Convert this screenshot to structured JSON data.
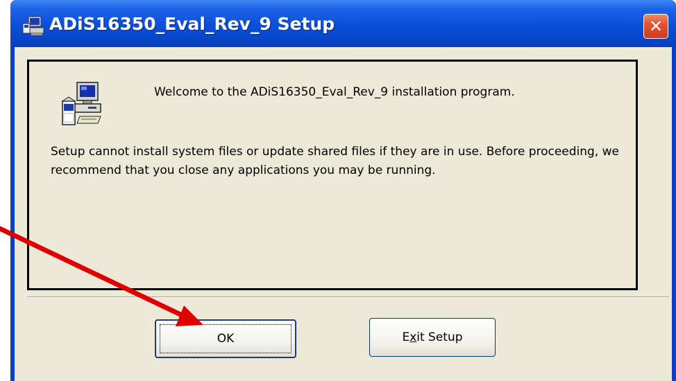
{
  "window": {
    "title": "ADiS16350_Eval_Rev_9 Setup",
    "close_glyph": "✕",
    "title_icon": "setup-computer-icon"
  },
  "dialog": {
    "welcome": "Welcome to the ADiS16350_Eval_Rev_9 installation program.",
    "message": "Setup cannot install system files or update shared files if they are in use. Before proceeding, we recommend that you close any applications you may be running.",
    "icon": "setup-computer-icon"
  },
  "buttons": {
    "ok_label": "OK",
    "exit_label_pre": "E",
    "exit_label_access": "x",
    "exit_label_post": "it Setup"
  },
  "annotation": {
    "arrow_color": "#e10000"
  },
  "colors": {
    "titlebar": "#0a4fd8",
    "client": "#ece9d8",
    "close_button": "#e05534"
  }
}
